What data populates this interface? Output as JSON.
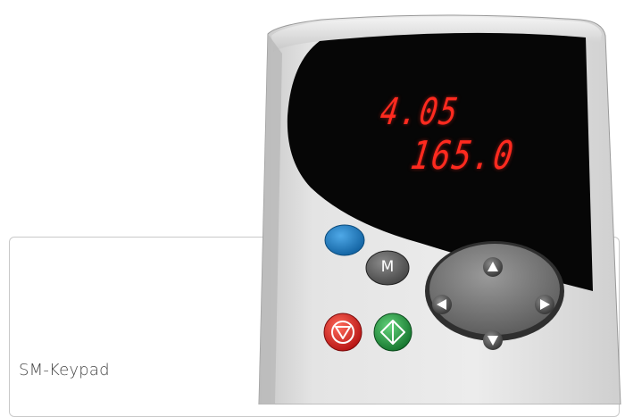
{
  "card": {
    "label": "SM-Keypad"
  },
  "display": {
    "line1": "4.05",
    "line2": "165.0",
    "segment_color": "#ff2a1f"
  },
  "keys": {
    "mode_label": "M",
    "blue_key_color": "#1f7ec8",
    "stop_color": "#d42020",
    "start_color": "#1f9a3a"
  },
  "navigation": {
    "up_icon": "triangle-up",
    "down_icon": "triangle-down",
    "left_icon": "triangle-left",
    "right_icon": "triangle-right"
  }
}
